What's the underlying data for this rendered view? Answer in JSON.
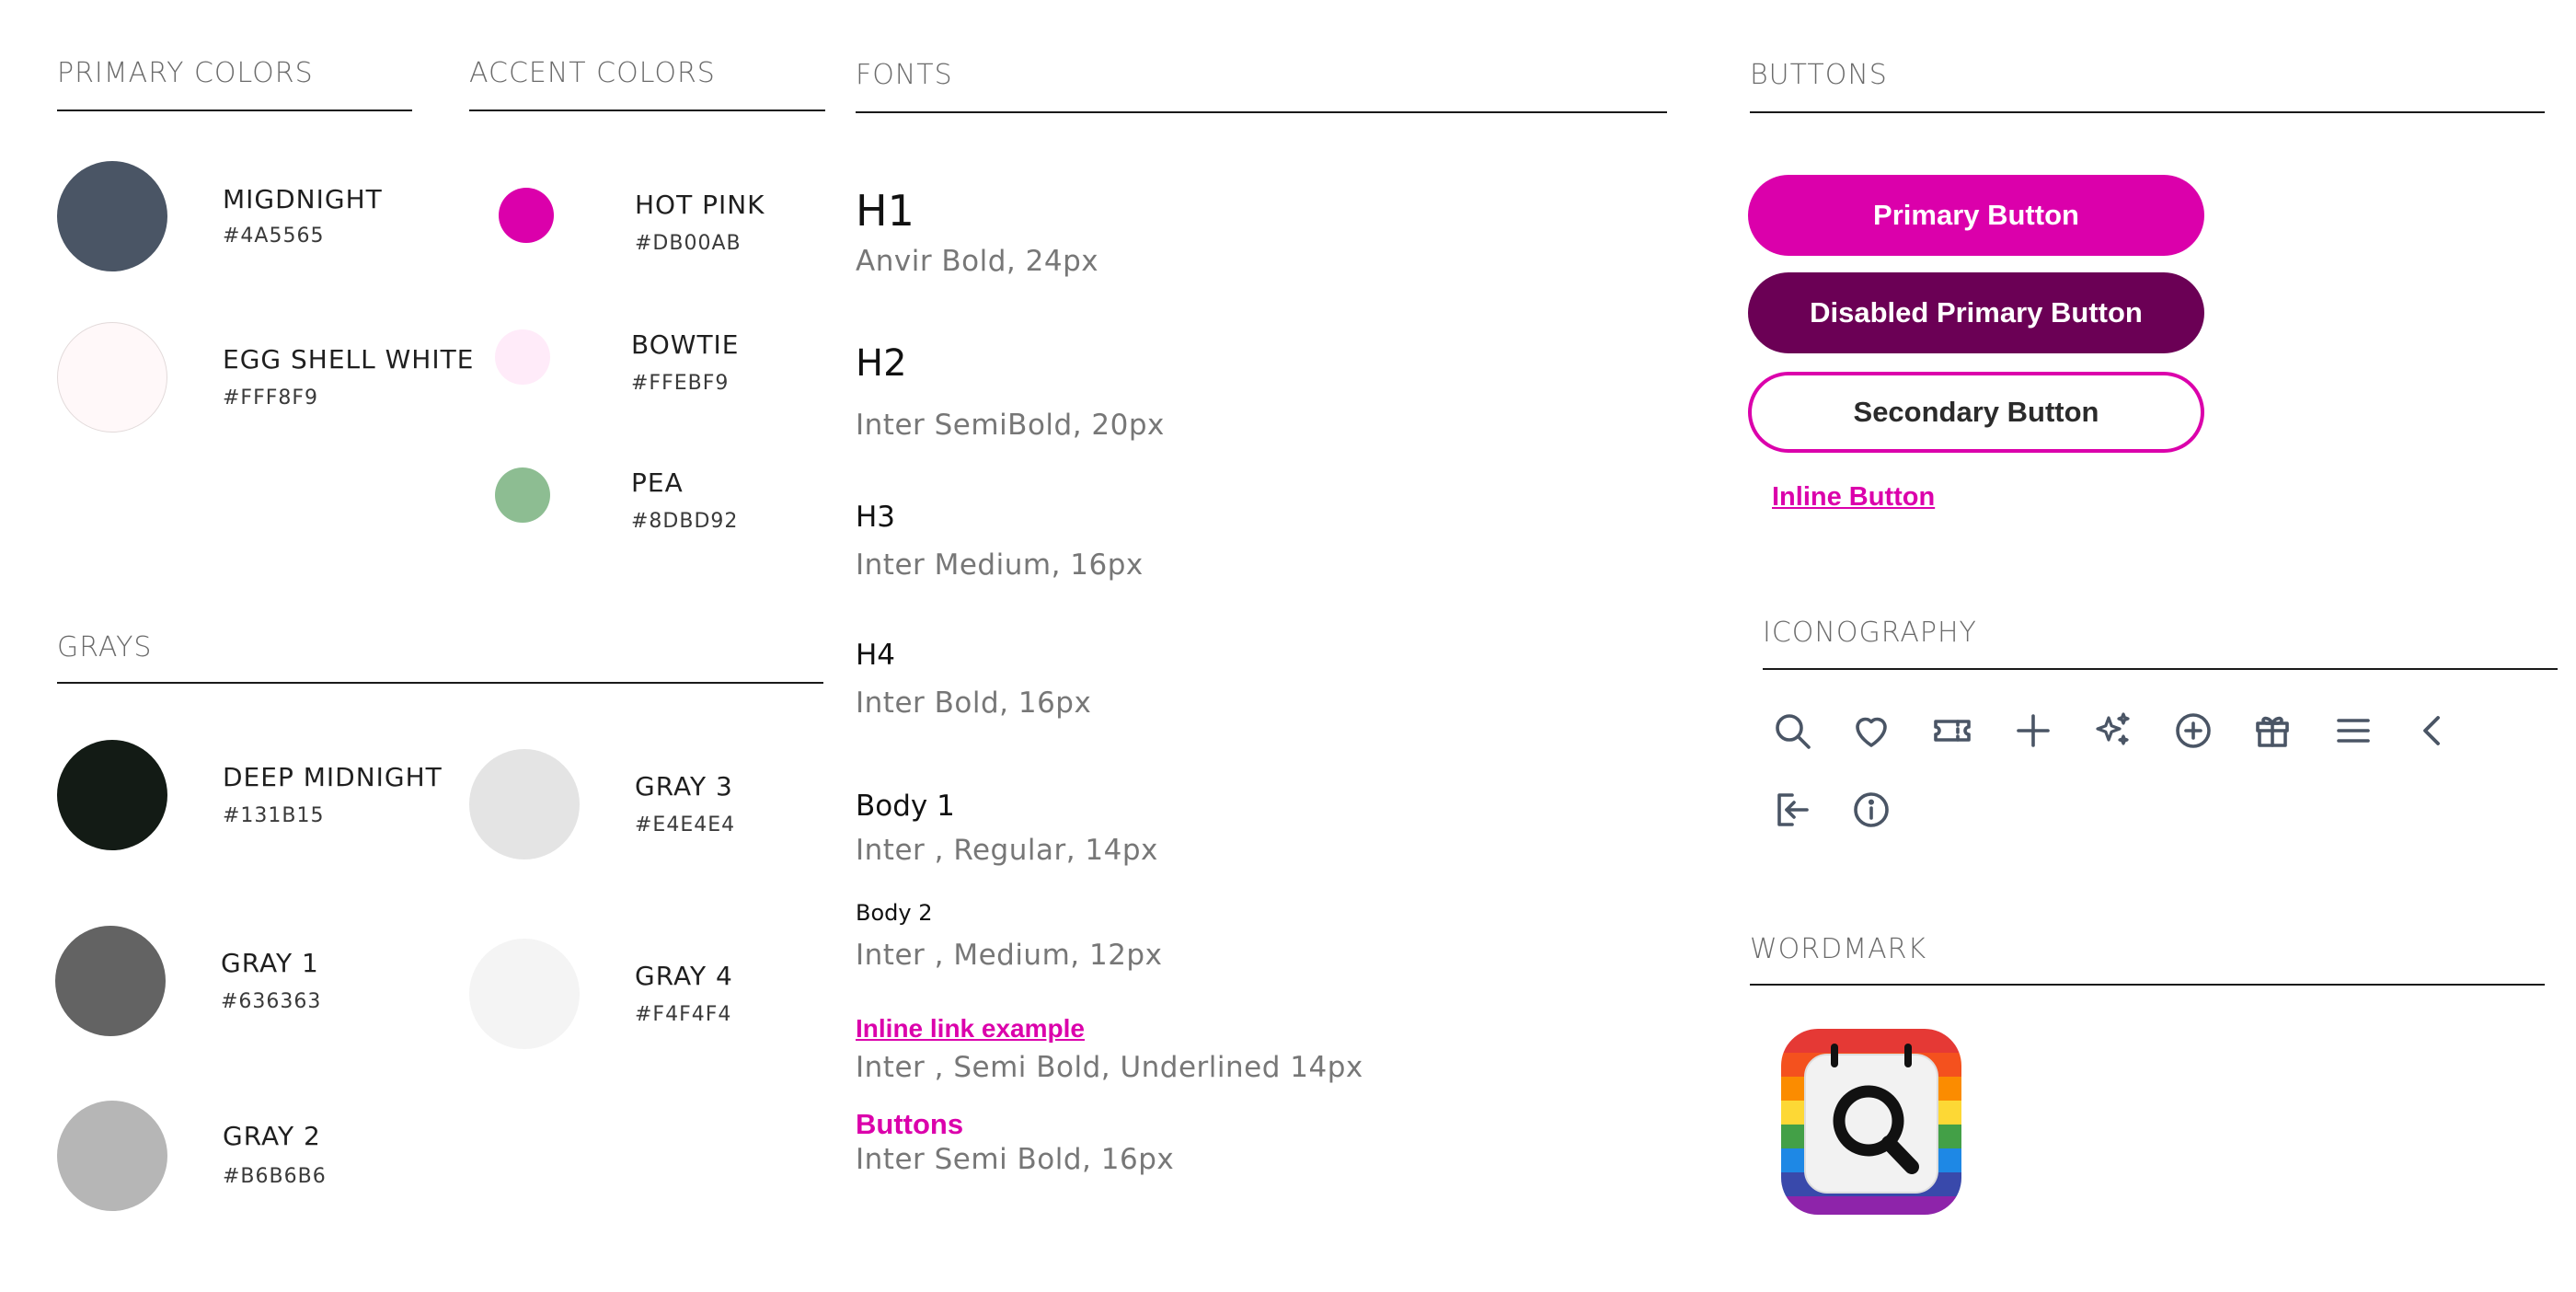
{
  "sections": {
    "primary": "PRIMARY COLORS",
    "accent": "ACCENT COLORS",
    "fonts": "FONTS",
    "buttons": "BUTTONS",
    "grays": "GRAYS",
    "iconography": "ICONOGRAPHY",
    "wordmark": "WORDMARK"
  },
  "primary_colors": [
    {
      "name": "MIGDNIGHT",
      "hex": "#4A5565",
      "color": "#4A5565"
    },
    {
      "name": "EGG SHELL WHITE",
      "hex": "#FFF8F9",
      "color": "#FFF8F9"
    }
  ],
  "accent_colors": [
    {
      "name": "HOT PINK",
      "hex": "#DB00AB",
      "color": "#DB00AB"
    },
    {
      "name": "BOWTIE",
      "hex": "#FFEBF9",
      "color": "#FFEBF9"
    },
    {
      "name": "PEA",
      "hex": "#8DBD92",
      "color": "#8DBD92"
    }
  ],
  "grays": [
    {
      "name": "DEEP MIDNIGHT",
      "hex": "#131B15",
      "color": "#131B15"
    },
    {
      "name": "GRAY 1",
      "hex": "#636363",
      "color": "#636363"
    },
    {
      "name": "GRAY 2",
      "hex": "#B6B6B6",
      "color": "#B6B6B6"
    },
    {
      "name": "GRAY 3",
      "hex": "#E4E4E4",
      "color": "#E4E4E4"
    },
    {
      "name": "GRAY 4",
      "hex": "#F4F4F4",
      "color": "#F4F4F4"
    }
  ],
  "fonts": {
    "h1": {
      "label": "H1",
      "desc": "Anvir Bold, 24px"
    },
    "h2": {
      "label": "H2",
      "desc": "Inter SemiBold, 20px"
    },
    "h3": {
      "label": "H3",
      "desc": "Inter Medium, 16px"
    },
    "h4": {
      "label": "H4",
      "desc": "Inter Bold, 16px"
    },
    "body1": {
      "label": "Body 1",
      "desc": "Inter , Regular, 14px"
    },
    "body2": {
      "label": "Body 2",
      "desc": "Inter , Medium, 12px"
    },
    "link": {
      "label": "Inline link example",
      "desc": "Inter , Semi Bold, Underlined 14px"
    },
    "buttons": {
      "label": "Buttons",
      "desc": "Inter Semi Bold, 16px"
    }
  },
  "buttons": {
    "primary": "Primary Button",
    "disabled": "Disabled Primary Button",
    "secondary": "Secondary Button",
    "inline": "Inline Button"
  },
  "icons": [
    "search-icon",
    "heart-icon",
    "ticket-icon",
    "plus-icon",
    "sparkles-icon",
    "plus-circle-icon",
    "gift-icon",
    "menu-icon",
    "chevron-left-icon",
    "login-icon",
    "info-icon"
  ],
  "colors": {
    "accent": "#DB00AB",
    "disabled": "#6B0055",
    "icon": "#4A5565",
    "rule": "#1A1A1A"
  }
}
